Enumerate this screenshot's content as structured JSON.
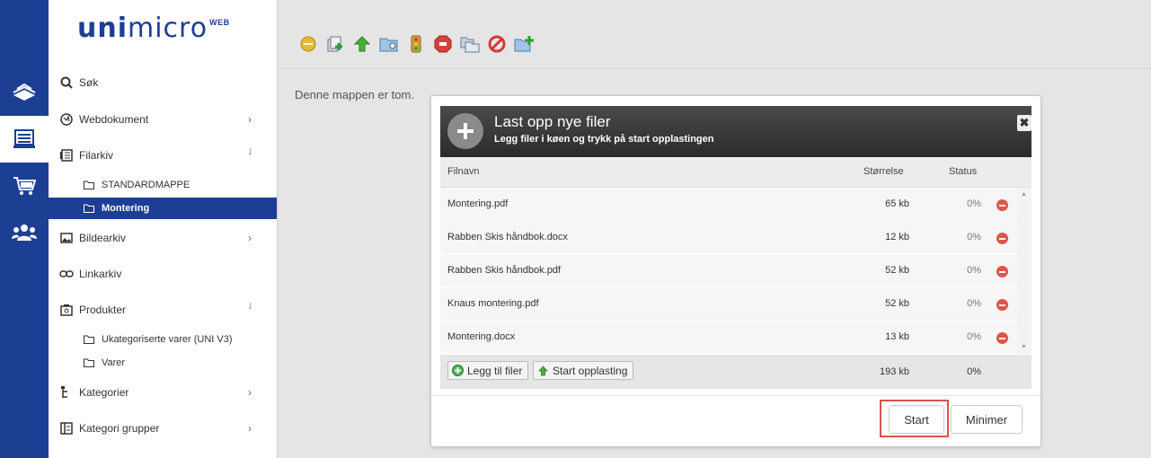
{
  "logo": {
    "uni": "uni",
    "micro": "micro",
    "sup": "WEB"
  },
  "rail": {
    "icons": [
      "content-stack-icon",
      "document-list-icon",
      "shopping-cart-icon",
      "users-icon"
    ],
    "active_index": 1
  },
  "sidebar": {
    "items": [
      {
        "label": "Søk",
        "icon": "search-icon"
      },
      {
        "label": "Webdokument",
        "icon": "globe-icon",
        "chevron": "›"
      },
      {
        "label": "Filarkiv",
        "icon": "archive-icon",
        "chevron": "˩"
      },
      {
        "label": "Bildearkiv",
        "icon": "image-icon",
        "chevron": "›"
      },
      {
        "label": "Linkarkiv",
        "icon": "link-icon"
      },
      {
        "label": "Produkter",
        "icon": "camera-box-icon",
        "chevron": "˩"
      },
      {
        "label": "Kategorier",
        "icon": "tree-icon",
        "chevron": "›"
      },
      {
        "label": "Kategori grupper",
        "icon": "category-group-icon",
        "chevron": "›"
      }
    ],
    "filarkiv_sub": [
      {
        "label": "STANDARDMAPPE"
      },
      {
        "label": "Montering"
      }
    ],
    "produkter_sub": [
      {
        "label": "Ukategoriserte varer (UNI V3)"
      },
      {
        "label": "Varer"
      }
    ]
  },
  "main": {
    "empty_message": "Denne mappen er tom."
  },
  "toolbar": {
    "icons": [
      "new-folder-icon",
      "add-files-icon",
      "upload-arrow-icon",
      "folder-settings-icon",
      "traffic-light-icon",
      "stop-icon",
      "move-folder-icon",
      "forbidden-icon",
      "add-folder-icon"
    ]
  },
  "upload_dialog": {
    "title": "Last opp nye filer",
    "subtitle": "Legg filer i køen og trykk på start opplastingen",
    "close_label": "✖",
    "columns": {
      "name": "Filnavn",
      "size": "Størrelse",
      "status": "Status"
    },
    "files": [
      {
        "name": "Montering.pdf",
        "size": "65 kb",
        "status": "0%"
      },
      {
        "name": "Rabben Skis håndbok.docx",
        "size": "12 kb",
        "status": "0%"
      },
      {
        "name": "Rabben Skis håndbok.pdf",
        "size": "52 kb",
        "status": "0%"
      },
      {
        "name": "Knaus montering.pdf",
        "size": "52 kb",
        "status": "0%"
      },
      {
        "name": "Montering.docx",
        "size": "13 kb",
        "status": "0%"
      }
    ],
    "add_files_label": "Legg til filer",
    "start_upload_label": "Start opplasting",
    "total_size": "193 kb",
    "total_status": "0%",
    "start_label": "Start",
    "minimize_label": "Minimer"
  },
  "colors": {
    "brand": "#1c3f94",
    "highlight": "#d9534f",
    "remove": "#e0564a"
  }
}
